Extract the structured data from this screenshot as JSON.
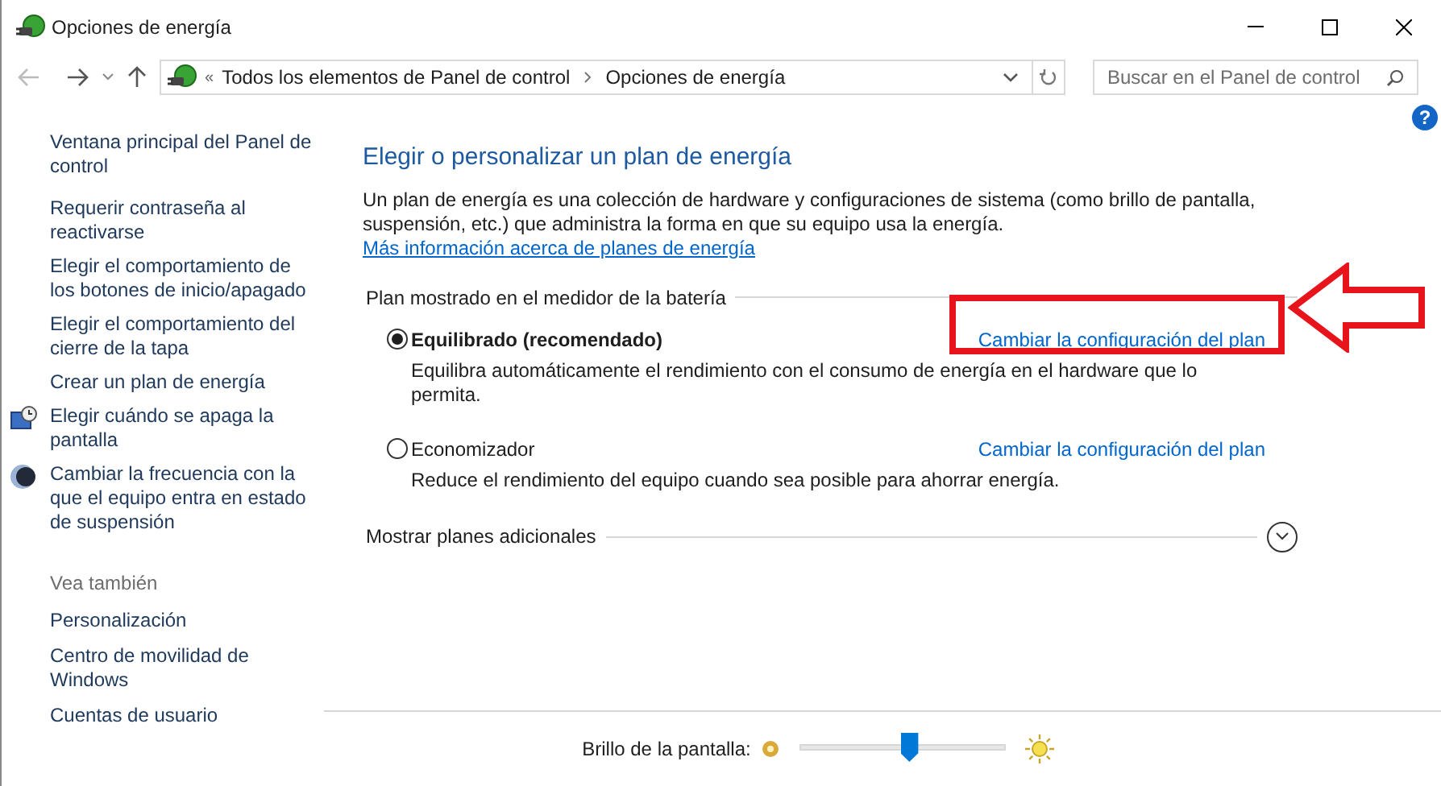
{
  "window": {
    "title": "Opciones de energía"
  },
  "address_bar": {
    "overflow": "«",
    "breadcrumbs": [
      "Todos los elementos de Panel de control",
      "Opciones de energía"
    ]
  },
  "search": {
    "placeholder": "Buscar en el Panel de control"
  },
  "help": "?",
  "sidebar": {
    "items": [
      {
        "label": "Ventana principal del Panel de control",
        "kind": "plain"
      },
      {
        "label": "Requerir contraseña al reactivarse",
        "kind": "plain"
      },
      {
        "label": "Elegir el comportamiento de los botones de inicio/apagado",
        "kind": "plain"
      },
      {
        "label": "Elegir el comportamiento del cierre de la tapa",
        "kind": "plain"
      },
      {
        "label": "Crear un plan de energía",
        "kind": "plain"
      },
      {
        "label": "Elegir cuándo se apaga la pantalla",
        "kind": "monitor"
      },
      {
        "label": "Cambiar la frecuencia con la que el equipo entra en estado de suspensión",
        "kind": "moon"
      }
    ],
    "see_also": {
      "heading": "Vea también",
      "items": [
        "Personalización",
        "Centro de movilidad de Windows",
        "Cuentas de usuario"
      ]
    }
  },
  "main": {
    "heading": "Elegir o personalizar un plan de energía",
    "intro": "Un plan de energía es una colección de hardware y configuraciones de sistema (como brillo de pantalla, suspensión, etc.) que administra la forma en que su equipo usa la energía.",
    "intro_link": "Más información acerca de planes de energía",
    "group_title": "Plan mostrado en el medidor de la batería",
    "plans": [
      {
        "name": "Equilibrado (recomendado)",
        "selected": true,
        "link": "Cambiar la configuración del plan",
        "highlighted": true,
        "description": "Equilibra automáticamente el rendimiento con el consumo de energía en el hardware que lo permita."
      },
      {
        "name": "Economizador",
        "selected": false,
        "link": "Cambiar la configuración del plan",
        "highlighted": false,
        "description": "Reduce el rendimiento del equipo cuando sea posible para ahorrar energía."
      }
    ],
    "more_plans": {
      "label": "Mostrar planes adicionales",
      "expanded": false
    }
  },
  "brightness": {
    "label": "Brillo de la pantalla:",
    "level": 0.53
  }
}
